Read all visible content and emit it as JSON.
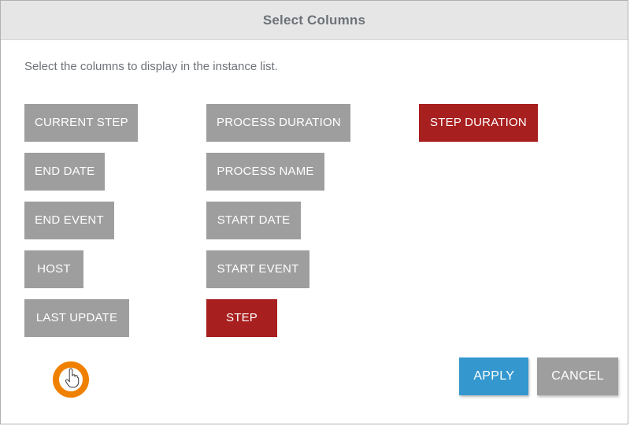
{
  "dialog": {
    "title": "Select Columns",
    "instructions": "Select the columns to display in the instance list."
  },
  "colors": {
    "selected": "#a81f1f",
    "deselected": "#9e9e9e",
    "apply": "#3498cf",
    "cancel": "#9e9e9e",
    "header_background": "#e6e6e6",
    "cursor_highlight": "#f08000",
    "text_muted": "#6d7278"
  },
  "columns": [
    {
      "chips": [
        {
          "label": "CURRENT STEP",
          "selected": false,
          "width": 144
        },
        {
          "label": "END DATE",
          "selected": false,
          "width": 102
        },
        {
          "label": "END EVENT",
          "selected": false,
          "width": 114
        },
        {
          "label": "HOST",
          "selected": false,
          "width": 75
        },
        {
          "label": "LAST UPDATE",
          "selected": false,
          "width": 133
        }
      ]
    },
    {
      "chips": [
        {
          "label": "PROCESS DURATION",
          "selected": false,
          "width": 183
        },
        {
          "label": "PROCESS NAME",
          "selected": false,
          "width": 150
        },
        {
          "label": "START DATE",
          "selected": false,
          "width": 120
        },
        {
          "label": "START EVENT",
          "selected": false,
          "width": 131
        },
        {
          "label": "STEP",
          "selected": true,
          "width": 90
        }
      ]
    },
    {
      "chips": [
        {
          "label": "STEP DURATION",
          "selected": true,
          "width": 151
        }
      ]
    }
  ],
  "footer": {
    "apply_label": "APPLY",
    "cancel_label": "CANCEL"
  },
  "cursor": {
    "icon": "pointing-hand-cursor",
    "highlight_visible": true
  }
}
